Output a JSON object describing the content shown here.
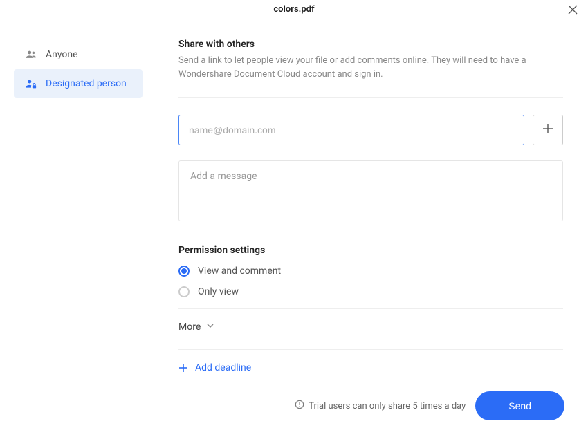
{
  "header": {
    "title": "colors.pdf"
  },
  "sidebar": {
    "items": [
      {
        "label": "Anyone",
        "selected": false
      },
      {
        "label": "Designated person",
        "selected": true
      }
    ]
  },
  "share": {
    "title": "Share with others",
    "description": "Send a link to let people view your file or add comments online. They will need to have a Wondershare Document Cloud account and sign in.",
    "email_placeholder": "name@domain.com",
    "email_value": "",
    "message_placeholder": "Add a message",
    "message_value": ""
  },
  "permissions": {
    "title": "Permission settings",
    "options": [
      {
        "label": "View and comment",
        "checked": true
      },
      {
        "label": "Only view",
        "checked": false
      }
    ]
  },
  "more": {
    "label": "More"
  },
  "deadline": {
    "label": "Add deadline"
  },
  "footer": {
    "trial_note": "Trial users can only share 5 times a day",
    "send_label": "Send"
  }
}
